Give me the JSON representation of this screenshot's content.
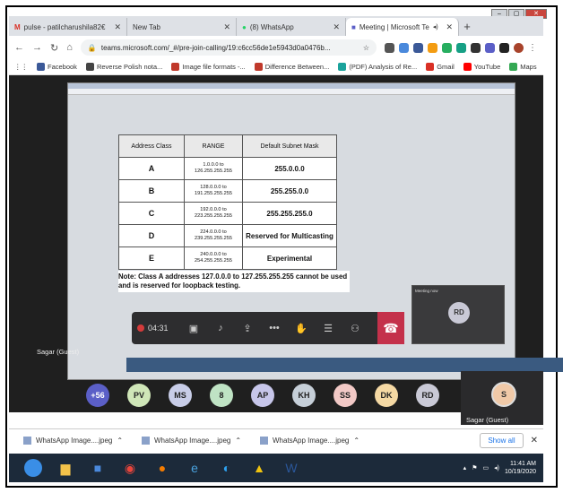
{
  "browser": {
    "tabs": [
      {
        "label": "pulse - patilcharushila82€"
      },
      {
        "label": "New Tab"
      },
      {
        "label": "(8) WhatsApp"
      },
      {
        "label": "Meeting | Microsoft Te"
      }
    ],
    "url": "teams.microsoft.com/_#/pre-join-calling/19:c6cc56de1e5943d0a0476b...",
    "bookmarks": [
      {
        "label": "Facebook",
        "color": "#3b5998"
      },
      {
        "label": "Reverse Polish nota...",
        "color": "#444444"
      },
      {
        "label": "Image file formats -...",
        "color": "#c0392b"
      },
      {
        "label": "Difference Between...",
        "color": "#c0392b"
      },
      {
        "label": "(PDF) Analysis of Re...",
        "color": "#1ba39c"
      },
      {
        "label": "Gmail",
        "color": "#d93025"
      },
      {
        "label": "YouTube",
        "color": "#ff0000"
      },
      {
        "label": "Maps",
        "color": "#34a853"
      }
    ]
  },
  "share": {
    "table_headers": [
      "Address Class",
      "RANGE",
      "Default Subnet Mask"
    ],
    "rows": [
      {
        "cls": "A",
        "range_from": "1.0.0.0 to",
        "range_to": "126.255.255.255",
        "mask": "255.0.0.0"
      },
      {
        "cls": "B",
        "range_from": "128.0.0.0 to",
        "range_to": "191.255.255.255",
        "mask": "255.255.0.0"
      },
      {
        "cls": "C",
        "range_from": "192.0.0.0 to",
        "range_to": "223.255.255.255",
        "mask": "255.255.255.0"
      },
      {
        "cls": "D",
        "range_from": "224.0.0.0 to",
        "range_to": "239.255.255.255",
        "mask": "Reserved for Multicasting"
      },
      {
        "cls": "E",
        "range_from": "240.0.0.0 to",
        "range_to": "254.255.255.255",
        "mask": "Experimental"
      }
    ],
    "note": "Note: Class A addresses 127.0.0.0 to 127.255.255.255 cannot be used and is reserved for loopback testing."
  },
  "call": {
    "timer": "04:31",
    "presenter_label": "Sagar (Guest)",
    "mini_title": "Meeting now",
    "mini_avatar": "RD"
  },
  "participants": [
    {
      "initials": "+56",
      "color": "#5b5fc7"
    },
    {
      "initials": "PV",
      "color": "#cfe6b8"
    },
    {
      "initials": "MS",
      "color": "#c8cde8"
    },
    {
      "initials": "8",
      "color": "#bfe3c4"
    },
    {
      "initials": "AP",
      "color": "#c7c6ea"
    },
    {
      "initials": "KH",
      "color": "#c6cfd8"
    },
    {
      "initials": "SS",
      "color": "#f2c9c6"
    },
    {
      "initials": "DK",
      "color": "#f5d9a4"
    },
    {
      "initials": "RD",
      "color": "#c9c9d6"
    }
  ],
  "self": {
    "initials": "S",
    "name": "Sagar (Guest)"
  },
  "downloads": {
    "items": [
      "WhatsApp Image....jpeg",
      "WhatsApp Image....jpeg",
      "WhatsApp Image....jpeg"
    ],
    "show_all": "Show all"
  },
  "taskbar": {
    "time": "11:41 AM",
    "date": "10/19/2020"
  }
}
